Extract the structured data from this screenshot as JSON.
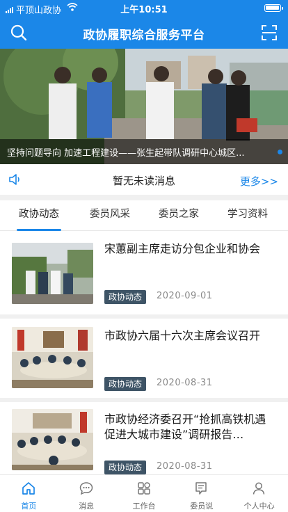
{
  "status_bar": {
    "carrier": "平顶山政协",
    "time": "上午10:51",
    "battery_level": 0.85
  },
  "header": {
    "title": "政协履职综合服务平台"
  },
  "banner": {
    "caption": "坚持问题导向 加速工程建设——张生起带队调研中心城区..."
  },
  "notice": {
    "text": "暂无未读消息",
    "more_label": "更多>>"
  },
  "tabs": [
    {
      "label": "政协动态",
      "active": true
    },
    {
      "label": "委员风采",
      "active": false
    },
    {
      "label": "委员之家",
      "active": false
    },
    {
      "label": "学习资料",
      "active": false
    }
  ],
  "news": [
    {
      "title": "宋蕙副主席走访分包企业和协会",
      "tag": "政协动态",
      "date": "2020-09-01"
    },
    {
      "title": "市政协六届十六次主席会议召开",
      "tag": "政协动态",
      "date": "2020-08-31"
    },
    {
      "title": "市政协经济委召开“抢抓高铁机遇 促进大城市建设”调研报告…",
      "tag": "政协动态",
      "date": "2020-08-31"
    }
  ],
  "bottom_nav": [
    {
      "label": "首页",
      "icon": "home-icon",
      "active": true
    },
    {
      "label": "消息",
      "icon": "message-icon",
      "active": false
    },
    {
      "label": "工作台",
      "icon": "workbench-icon",
      "active": false
    },
    {
      "label": "委员说",
      "icon": "member-speak-icon",
      "active": false
    },
    {
      "label": "个人中心",
      "icon": "profile-icon",
      "active": false
    }
  ],
  "colors": {
    "primary": "#1b87e8",
    "tag_bg": "#3e5466",
    "date": "#8a8a8a"
  }
}
